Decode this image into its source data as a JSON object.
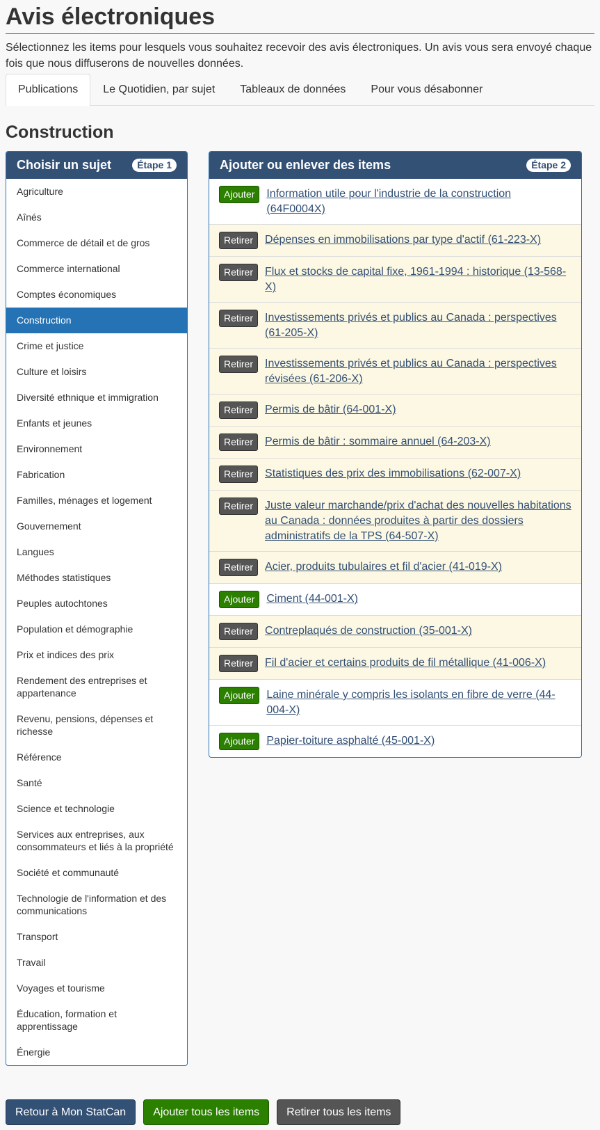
{
  "page": {
    "title": "Avis électroniques",
    "intro": "Sélectionnez les items pour lesquels vous souhaitez recevoir des avis électroniques. Un avis vous sera envoyé chaque fois que nous diffuserons de nouvelles données."
  },
  "tabs": [
    {
      "label": "Publications"
    },
    {
      "label": "Le Quotidien, par sujet"
    },
    {
      "label": "Tableaux de données"
    },
    {
      "label": "Pour vous désabonner"
    }
  ],
  "section_title": "Construction",
  "left_panel": {
    "title": "Choisir un sujet",
    "step": "Étape 1",
    "subjects": [
      "Agriculture",
      "Aînés",
      "Commerce de détail et de gros",
      "Commerce international",
      "Comptes économiques",
      "Construction",
      "Crime et justice",
      "Culture et loisirs",
      "Diversité ethnique et immigration",
      "Enfants et jeunes",
      "Environnement",
      "Fabrication",
      "Familles, ménages et logement",
      "Gouvernement",
      "Langues",
      "Méthodes statistiques",
      "Peuples autochtones",
      "Population et démographie",
      "Prix et indices des prix",
      "Rendement des entreprises et appartenance",
      "Revenu, pensions, dépenses et richesse",
      "Référence",
      "Santé",
      "Science et technologie",
      "Services aux entreprises, aux consommateurs et liés à la propriété",
      "Société et communauté",
      "Technologie de l'information et des communications",
      "Transport",
      "Travail",
      "Voyages et tourisme",
      "Éducation, formation et apprentissage",
      "Énergie"
    ]
  },
  "right_panel": {
    "title": "Ajouter ou enlever des items",
    "step": "Étape 2",
    "add_label": "Ajouter",
    "remove_label": "Retirer",
    "items": [
      {
        "text": "Information utile pour l'industrie de la construction (64F0004X)",
        "selected": false
      },
      {
        "text": "Dépenses en immobilisations par type d'actif (61-223-X)",
        "selected": true
      },
      {
        "text": "Flux et stocks de capital fixe, 1961-1994 : historique (13-568-X)",
        "selected": true
      },
      {
        "text": "Investissements privés et publics au Canada : perspectives (61-205-X)",
        "selected": true
      },
      {
        "text": "Investissements privés et publics au Canada : perspectives révisées (61-206-X)",
        "selected": true
      },
      {
        "text": "Permis de bâtir (64-001-X)",
        "selected": true
      },
      {
        "text": "Permis de bâtir : sommaire annuel (64-203-X)",
        "selected": true
      },
      {
        "text": "Statistiques des prix des immobilisations (62-007-X)",
        "selected": true
      },
      {
        "text": "Juste valeur marchande/prix d'achat des nouvelles habitations au Canada : données produites à partir des dossiers administratifs de la TPS (64-507-X)",
        "selected": true
      },
      {
        "text": "Acier, produits tubulaires et fil d'acier (41-019-X)",
        "selected": true
      },
      {
        "text": "Ciment (44-001-X)",
        "selected": false
      },
      {
        "text": "Contreplaqués de construction (35-001-X)",
        "selected": true
      },
      {
        "text": "Fil d'acier et certains produits de fil métallique (41-006-X)",
        "selected": true
      },
      {
        "text": "Laine minérale y compris les isolants en fibre de verre (44-004-X)",
        "selected": false
      },
      {
        "text": "Papier-toiture asphalté (45-001-X)",
        "selected": false
      }
    ]
  },
  "footer": {
    "back_label": "Retour à Mon StatCan",
    "add_all_label": "Ajouter tous les items",
    "remove_all_label": "Retirer tous les items"
  },
  "colors": {
    "panel_header": "#335075",
    "active_subject": "#2572b4",
    "add_button": "#2b8000",
    "remove_button": "#555555",
    "selected_row": "#fcf8e3"
  }
}
